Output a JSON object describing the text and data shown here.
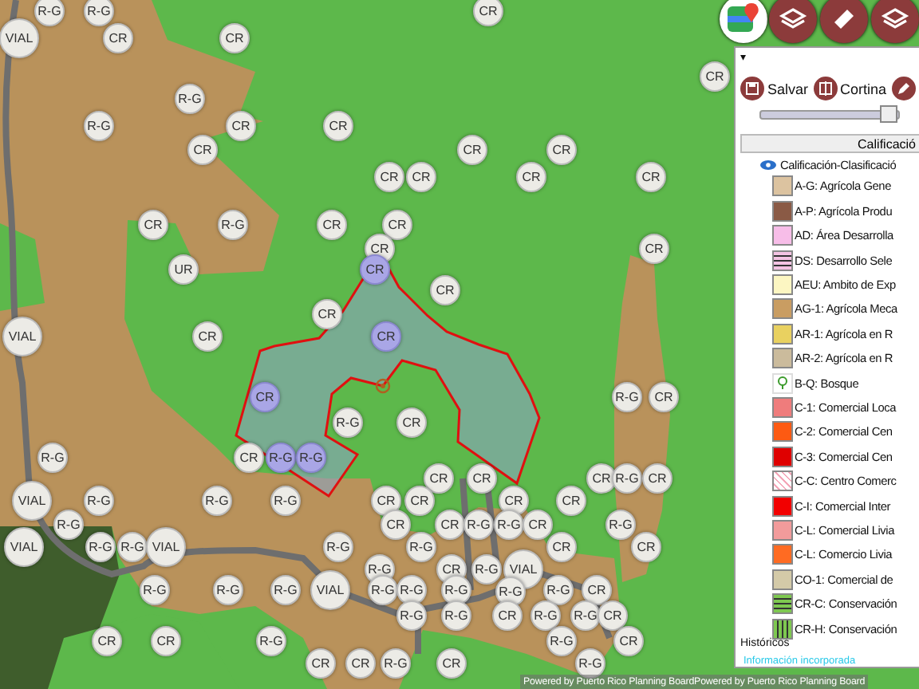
{
  "map": {
    "labels": [
      {
        "text": "R-G",
        "kind": "zone"
      },
      {
        "text": "R-G",
        "kind": "zone"
      },
      {
        "text": "CR",
        "kind": "zone"
      },
      {
        "text": "VIAL",
        "kind": "large"
      },
      {
        "text": "CR",
        "kind": "zone"
      },
      {
        "text": "CR",
        "kind": "zone"
      },
      {
        "text": "CR",
        "kind": "zone"
      },
      {
        "text": "R-G",
        "kind": "zone"
      },
      {
        "text": "R-G",
        "kind": "zone"
      },
      {
        "text": "CR",
        "kind": "zone"
      },
      {
        "text": "CR",
        "kind": "zone"
      },
      {
        "text": "CR",
        "kind": "zone"
      },
      {
        "text": "CR",
        "kind": "zone"
      },
      {
        "text": "CR",
        "kind": "zone"
      },
      {
        "text": "CR",
        "kind": "zone"
      },
      {
        "text": "CR",
        "kind": "zone"
      },
      {
        "text": "CR",
        "kind": "zone"
      },
      {
        "text": "CR",
        "kind": "zone"
      },
      {
        "text": "CR",
        "kind": "zone"
      },
      {
        "text": "R-G",
        "kind": "zone"
      },
      {
        "text": "CR",
        "kind": "zone"
      },
      {
        "text": "CR",
        "kind": "zone"
      },
      {
        "text": "CR",
        "kind": "zone"
      },
      {
        "text": "CR",
        "kind": "zone"
      },
      {
        "text": "UR",
        "kind": "zone"
      },
      {
        "text": "CR",
        "kind": "selected"
      },
      {
        "text": "CR",
        "kind": "zone"
      },
      {
        "text": "CR",
        "kind": "zone"
      },
      {
        "text": "VIAL",
        "kind": "large"
      },
      {
        "text": "CR",
        "kind": "zone"
      },
      {
        "text": "CR",
        "kind": "selected"
      },
      {
        "text": "CR",
        "kind": "selected"
      },
      {
        "text": "R-G",
        "kind": "zone"
      },
      {
        "text": "CR",
        "kind": "zone"
      },
      {
        "text": "R-G",
        "kind": "zone"
      },
      {
        "text": "CR",
        "kind": "zone"
      },
      {
        "text": "R-G",
        "kind": "zone"
      },
      {
        "text": "CR",
        "kind": "zone"
      },
      {
        "text": "R-G",
        "kind": "selected"
      },
      {
        "text": "R-G",
        "kind": "selected"
      },
      {
        "text": "CR",
        "kind": "zone"
      },
      {
        "text": "CR",
        "kind": "zone"
      },
      {
        "text": "CR",
        "kind": "zone"
      },
      {
        "text": "R-G",
        "kind": "zone"
      },
      {
        "text": "CR",
        "kind": "zone"
      },
      {
        "text": "VIAL",
        "kind": "large"
      },
      {
        "text": "R-G",
        "kind": "zone"
      },
      {
        "text": "R-G",
        "kind": "zone"
      },
      {
        "text": "R-G",
        "kind": "zone"
      },
      {
        "text": "CR",
        "kind": "zone"
      },
      {
        "text": "CR",
        "kind": "zone"
      },
      {
        "text": "CR",
        "kind": "zone"
      },
      {
        "text": "CR",
        "kind": "zone"
      },
      {
        "text": "R-G",
        "kind": "zone"
      },
      {
        "text": "CR",
        "kind": "zone"
      },
      {
        "text": "CR",
        "kind": "zone"
      },
      {
        "text": "R-G",
        "kind": "zone"
      },
      {
        "text": "R-G",
        "kind": "zone"
      },
      {
        "text": "CR",
        "kind": "zone"
      },
      {
        "text": "R-G",
        "kind": "zone"
      },
      {
        "text": "VIAL",
        "kind": "large"
      },
      {
        "text": "R-G",
        "kind": "zone"
      },
      {
        "text": "R-G",
        "kind": "zone"
      },
      {
        "text": "VIAL",
        "kind": "large"
      },
      {
        "text": "R-G",
        "kind": "zone"
      },
      {
        "text": "R-G",
        "kind": "zone"
      },
      {
        "text": "CR",
        "kind": "zone"
      },
      {
        "text": "CR",
        "kind": "zone"
      },
      {
        "text": "R-G",
        "kind": "zone"
      },
      {
        "text": "CR",
        "kind": "zone"
      },
      {
        "text": "R-G",
        "kind": "zone"
      },
      {
        "text": "VIAL",
        "kind": "large"
      },
      {
        "text": "R-G",
        "kind": "zone"
      },
      {
        "text": "R-G",
        "kind": "zone"
      },
      {
        "text": "R-G",
        "kind": "zone"
      },
      {
        "text": "VIAL",
        "kind": "large"
      },
      {
        "text": "R-G",
        "kind": "zone"
      },
      {
        "text": "R-G",
        "kind": "zone"
      },
      {
        "text": "R-G",
        "kind": "zone"
      },
      {
        "text": "R-G",
        "kind": "zone"
      },
      {
        "text": "R-G",
        "kind": "zone"
      },
      {
        "text": "CR",
        "kind": "zone"
      },
      {
        "text": "R-G",
        "kind": "zone"
      },
      {
        "text": "R-G",
        "kind": "zone"
      },
      {
        "text": "CR",
        "kind": "zone"
      },
      {
        "text": "R-G",
        "kind": "zone"
      },
      {
        "text": "R-G",
        "kind": "zone"
      },
      {
        "text": "CR",
        "kind": "zone"
      },
      {
        "text": "CR",
        "kind": "zone"
      },
      {
        "text": "CR",
        "kind": "zone"
      },
      {
        "text": "R-G",
        "kind": "zone"
      },
      {
        "text": "R-G",
        "kind": "zone"
      },
      {
        "text": "CR",
        "kind": "zone"
      },
      {
        "text": "CR",
        "kind": "zone"
      },
      {
        "text": "CR",
        "kind": "zone"
      },
      {
        "text": "R-G",
        "kind": "zone"
      },
      {
        "text": "CR",
        "kind": "zone"
      },
      {
        "text": "R-G",
        "kind": "zone"
      }
    ],
    "attribution": "Powered by Puerto Rico Planning BoardPowered by Puerto Rico Planning Board"
  },
  "panel": {
    "caret": "▾",
    "buttons": [
      {
        "label": "Salvar",
        "kind": "save"
      },
      {
        "label": "Cortina",
        "kind": "curtain"
      },
      {
        "kind": "edit"
      }
    ],
    "slider": {
      "level": 0.93
    },
    "header": "Calificació",
    "layer": {
      "label": "Calificación-Clasificació",
      "visible": true
    },
    "legend": [
      {
        "label": "A-G: Agrícola Gene",
        "kind": "solid",
        "color": "#dcc3a0"
      },
      {
        "label": "A-P: Agrícola Produ",
        "kind": "solid",
        "color": "#8a5a45"
      },
      {
        "label": "AD: Área Desarrolla",
        "kind": "solid",
        "color": "#f7bde8"
      },
      {
        "label": "DS: Desarrollo Sele",
        "kind": "stripes-h",
        "color": "#f4c3e3"
      },
      {
        "label": "AEU: Ambito de Exp",
        "kind": "solid",
        "color": "#fcf6c2"
      },
      {
        "label": "AG-1: Agrícola Meca",
        "kind": "solid",
        "color": "#c99d62"
      },
      {
        "label": "AR-1: Agrícola en R",
        "kind": "solid",
        "color": "#e9d160"
      },
      {
        "label": "AR-2: Agrícola en R",
        "kind": "solid",
        "color": "#cbbb9c"
      },
      {
        "label": "B-Q: Bosque",
        "kind": "tree",
        "color": "#ffffff"
      },
      {
        "label": "C-1: Comercial Loca",
        "kind": "solid",
        "color": "#ef7c7c"
      },
      {
        "label": "C-2: Comercial Cen",
        "kind": "solid",
        "color": "#fd5a12"
      },
      {
        "label": "C-3: Comercial Cen",
        "kind": "solid",
        "color": "#df0000"
      },
      {
        "label": "C-C: Centro Comerc",
        "kind": "diagonal",
        "color": "#f4a6b8"
      },
      {
        "label": "C-I: Comercial Inter",
        "kind": "solid",
        "color": "#f20000"
      },
      {
        "label": "C-L: Comercial Livia",
        "kind": "solid",
        "color": "#f29b9b"
      },
      {
        "label": "C-L: Comercio Livia",
        "kind": "solid",
        "color": "#ff6b22"
      },
      {
        "label": "CO-1: Comercial de",
        "kind": "solid",
        "color": "#d4caa8"
      },
      {
        "label": "CR-C: Conservación",
        "kind": "stripes-h",
        "color": "#7ec850"
      },
      {
        "label": "CR-H: Conservación",
        "kind": "stripes-v",
        "color": "#7ec850"
      }
    ],
    "section": "Históricos",
    "link": "Información incorporada"
  }
}
